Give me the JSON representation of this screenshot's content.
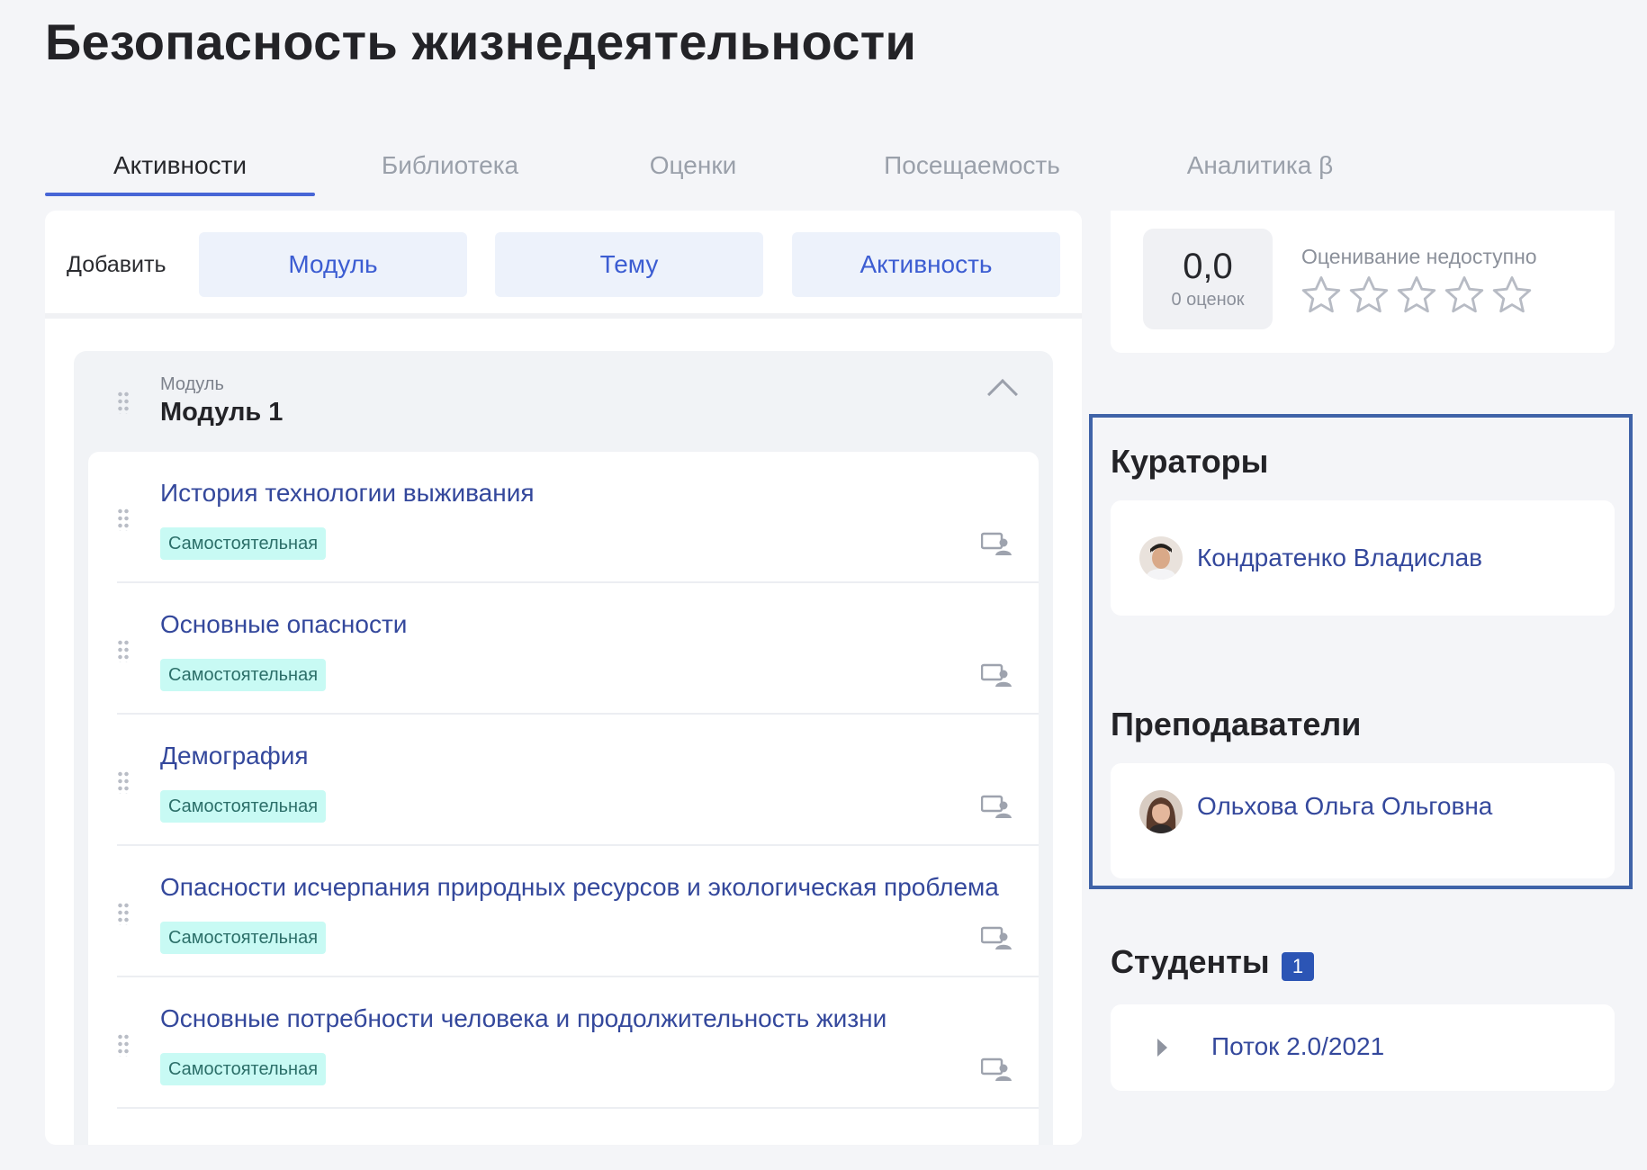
{
  "page": {
    "title": "Безопасность жизнедеятельности"
  },
  "tabs": [
    {
      "label": "Активности",
      "active": true
    },
    {
      "label": "Библиотека",
      "active": false
    },
    {
      "label": "Оценки",
      "active": false
    },
    {
      "label": "Посещаемость",
      "active": false
    },
    {
      "label": "Аналитика β",
      "active": false
    }
  ],
  "add_bar": {
    "label": "Добавить",
    "buttons": [
      {
        "label": "Модуль"
      },
      {
        "label": "Тему"
      },
      {
        "label": "Активность"
      }
    ]
  },
  "module": {
    "kicker": "Модуль",
    "title": "Модуль 1",
    "expanded": true,
    "activities": [
      {
        "title": "История технологии выживания",
        "badge": "Самостоятельная"
      },
      {
        "title": "Основные опасности",
        "badge": "Самостоятельная"
      },
      {
        "title": "Демография",
        "badge": "Самостоятельная"
      },
      {
        "title": "Опасности исчерпания природных ресурсов и экологическая проблема",
        "badge": "Самостоятельная"
      },
      {
        "title": "Основные потребности человека и продолжительность жизни",
        "badge": "Самостоятельная"
      }
    ]
  },
  "rating": {
    "score": "0,0",
    "count_label": "0 оценок",
    "note": "Оценивание недоступно",
    "stars_filled": 0,
    "stars_total": 5
  },
  "curators": {
    "title": "Кураторы",
    "people": [
      {
        "name": "Кондратенко Владислав",
        "icon": "avatar-man"
      }
    ]
  },
  "teachers": {
    "title": "Преподаватели",
    "people": [
      {
        "name": "Ольхова Ольга Ольговна",
        "icon": "avatar-woman"
      }
    ]
  },
  "students": {
    "title": "Студенты",
    "count": "1",
    "streams": [
      {
        "label": "Поток 2.0/2021"
      }
    ]
  },
  "colors": {
    "accent": "#4765d6",
    "link": "#34489c",
    "badge_bg": "#c8faf4",
    "badge_text": "#2c6f69",
    "highlight_frame": "#3f63a8",
    "count_badge": "#2c55b5"
  }
}
